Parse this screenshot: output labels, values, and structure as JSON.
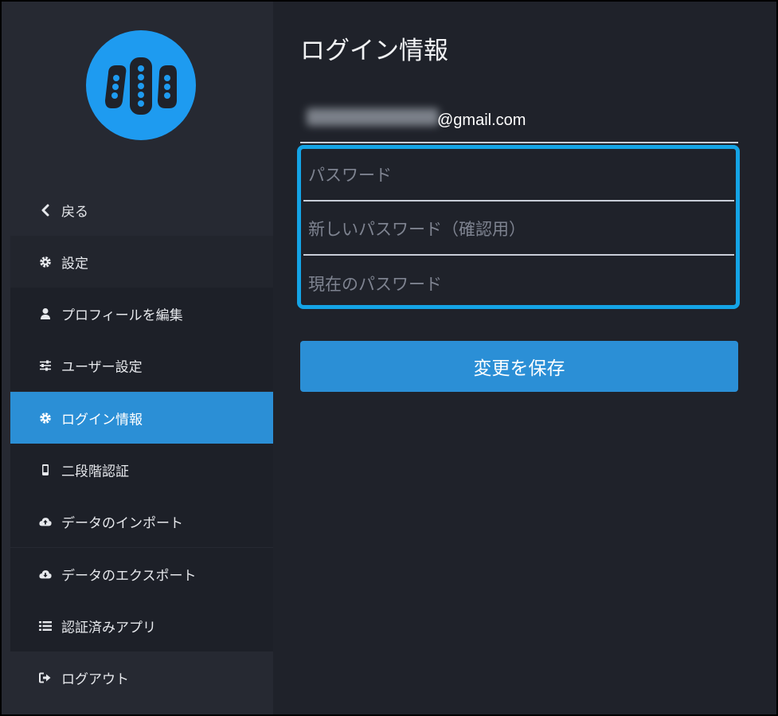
{
  "sidebar": {
    "items": [
      {
        "label": "戻る",
        "icon": "chevron-left-icon"
      },
      {
        "label": "設定",
        "icon": "gear-icon"
      },
      {
        "label": "プロフィールを編集",
        "icon": "user-icon"
      },
      {
        "label": "ユーザー設定",
        "icon": "sliders-icon"
      },
      {
        "label": "ログイン情報",
        "icon": "gear-icon"
      },
      {
        "label": "二段階認証",
        "icon": "mobile-icon"
      },
      {
        "label": "データのインポート",
        "icon": "cloud-upload-icon"
      },
      {
        "label": "データのエクスポート",
        "icon": "cloud-download-icon"
      },
      {
        "label": "認証済みアプリ",
        "icon": "list-icon"
      },
      {
        "label": "ログアウト",
        "icon": "sign-out-icon"
      }
    ]
  },
  "main": {
    "title": "ログイン情報",
    "email_domain": "@gmail.com",
    "password_placeholder": "パスワード",
    "new_password_confirm_placeholder": "新しいパスワード（確認用）",
    "current_password_placeholder": "現在のパスワード",
    "save_label": "変更を保存"
  },
  "colors": {
    "accent": "#2b8fd6",
    "highlight_border": "#14a4e6",
    "logo": "#1e9bf0",
    "background": "#1f222a",
    "sidebar": "#262932"
  }
}
